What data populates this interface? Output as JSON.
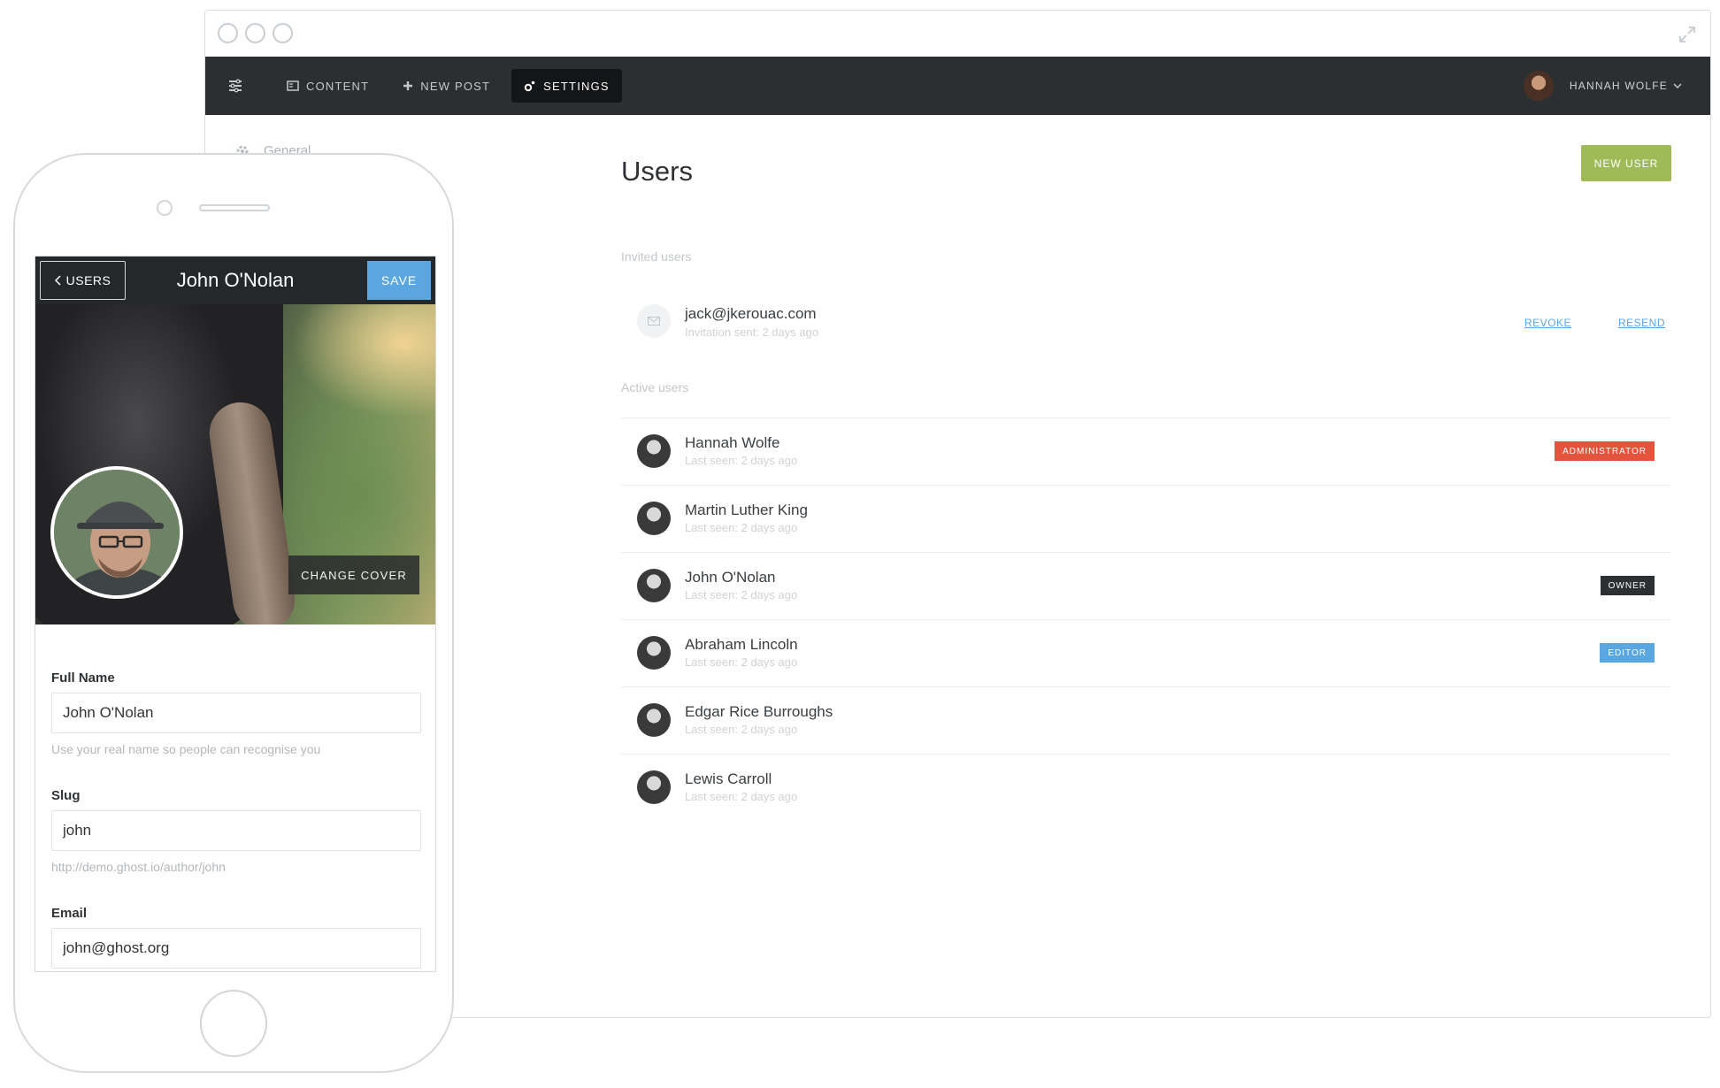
{
  "nav": {
    "items": [
      {
        "label": "CONTENT",
        "icon": "content-icon"
      },
      {
        "label": "NEW POST",
        "icon": "plus-icon"
      },
      {
        "label": "SETTINGS",
        "icon": "gear-icon"
      }
    ],
    "user_name": "HANNAH WOLFE"
  },
  "sidebar": {
    "items": [
      {
        "label": "General",
        "icon": "gear-icon"
      }
    ]
  },
  "main": {
    "title": "Users",
    "new_user_label": "NEW USER",
    "invited_label": "Invited users",
    "invited": [
      {
        "email": "jack@jkerouac.com",
        "sent": "Invitation sent: 2 days ago",
        "revoke": "REVOKE",
        "resend": "RESEND"
      }
    ],
    "active_label": "Active users",
    "users": [
      {
        "name": "Hannah Wolfe",
        "seen": "Last seen: 2 days ago",
        "role": "ADMINISTRATOR",
        "role_color": "#e4543c"
      },
      {
        "name": "Martin Luther King",
        "seen": "Last seen: 2 days ago",
        "role": "",
        "role_color": ""
      },
      {
        "name": "John O'Nolan",
        "seen": "Last seen: 2 days ago",
        "role": "OWNER",
        "role_color": "#2d3032"
      },
      {
        "name": "Abraham Lincoln",
        "seen": "Last seen: 2 days ago",
        "role": "EDITOR",
        "role_color": "#5aa6e0"
      },
      {
        "name": "Edgar Rice Burroughs",
        "seen": "Last seen: 2 days ago",
        "role": "",
        "role_color": ""
      },
      {
        "name": "Lewis Carroll",
        "seen": "Last seen: 2 days ago",
        "role": "",
        "role_color": ""
      }
    ]
  },
  "mobile": {
    "back_label": "USERS",
    "title": "John O'Nolan",
    "save_label": "SAVE",
    "change_cover_label": "CHANGE COVER",
    "full_name": {
      "label": "Full Name",
      "value": "John O'Nolan",
      "help": "Use your real name so people can recognise you"
    },
    "slug": {
      "label": "Slug",
      "value": "john",
      "help": "http://demo.ghost.io/author/john"
    },
    "email": {
      "label": "Email",
      "value": "john@ghost.org"
    }
  },
  "colors": {
    "accent_green": "#9fbb58",
    "nav_dark": "#2c2f31",
    "link_blue": "#5ba4e5",
    "save_blue": "#5aa6e0"
  }
}
